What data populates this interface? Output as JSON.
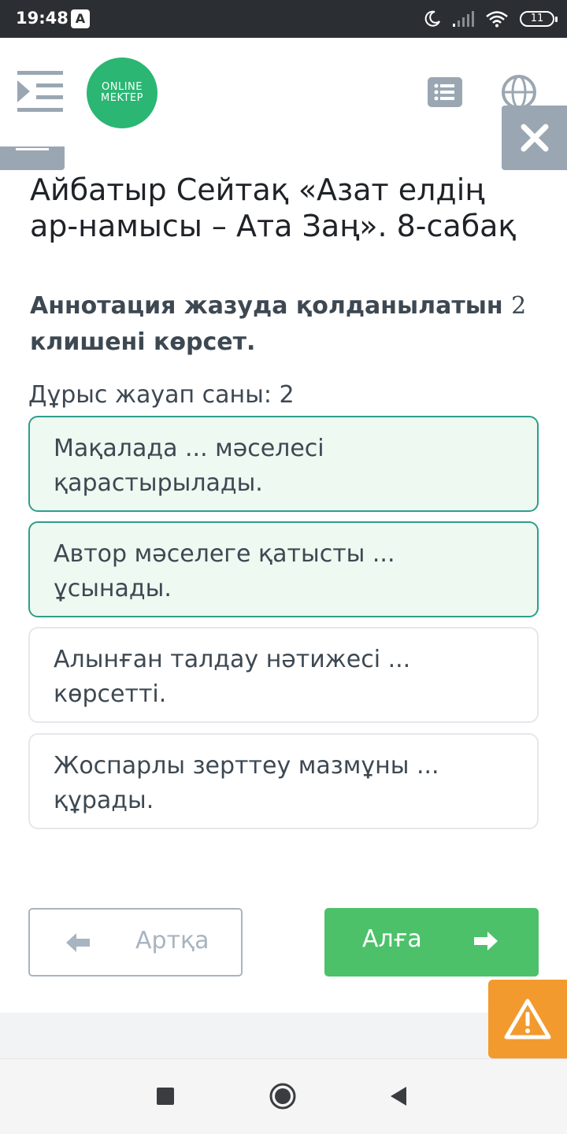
{
  "status_bar": {
    "time": "19:48",
    "app_badge": "A",
    "battery": "11"
  },
  "header": {
    "logo_line1": "ONLINE",
    "logo_line2": "MEKTEP",
    "icons": [
      "menu-collapse-icon",
      "list-icon",
      "globe-icon",
      "close-icon"
    ]
  },
  "lesson": {
    "title": "Айбатыр Сейтақ «Азат елдің ар-намысы – Ата Заң». 8-сабақ"
  },
  "question": {
    "text_before": "Аннотация жазуда қолданылатын ",
    "number": "2",
    "text_after": " клишені көрсет.",
    "answers_count": "Дұрыс жауап саны: 2"
  },
  "options": [
    {
      "text": "Мақалада ... мәселесі қарастырылады.",
      "selected": true
    },
    {
      "text": "Автор мәселеге қатысты ... ұсынады.",
      "selected": true
    },
    {
      "text": "Алынған талдау нәтижесі ... көрсетті.",
      "selected": false
    },
    {
      "text": "Жоспарлы зерттеу мазмұны ... құрады.",
      "selected": false
    }
  ],
  "navigation": {
    "back_label": "Артқа",
    "next_label": "Алға"
  },
  "colors": {
    "accent_green": "#4cc16a",
    "selected_border": "#2e9e8a",
    "selected_bg": "#edf9f1",
    "warning": "#f29a2e",
    "icon_gray": "#9aa7b3"
  }
}
